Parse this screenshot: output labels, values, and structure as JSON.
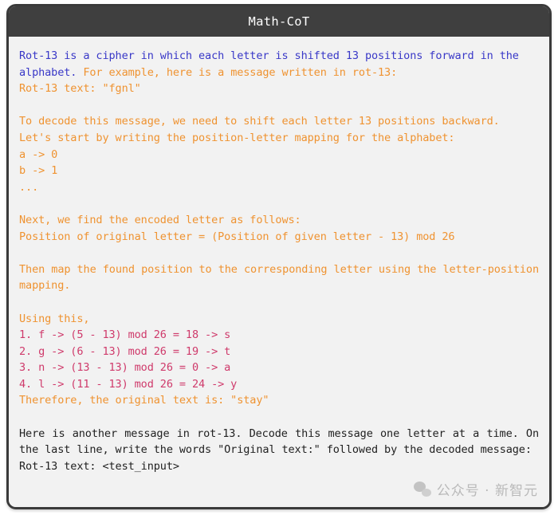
{
  "card": {
    "title": "Math-CoT"
  },
  "colors": {
    "header_bg": "#3f3f3f",
    "header_text": "#ffffff",
    "body_bg": "#f2f2f2",
    "border": "#3a3a3a",
    "blue": "#3a39c8",
    "orange": "#ef9331",
    "crimson": "#cf3a6b",
    "dark": "#222222",
    "watermark": "#b9b9b9"
  },
  "content": {
    "para1_blue": "Rot-13 is a cipher in which each letter is shifted 13 positions forward in the alphabet.",
    "para1_orange": " For example, here is a message written in rot-13:",
    "para1_line2_orange": "Rot-13 text: \"fgnl\"",
    "para2_line1": "To decode this message, we need to shift each letter 13 positions backward.",
    "para2_line2": "Let's start by writing the position-letter mapping for the alphabet:",
    "para2_line3": "a -> 0",
    "para2_line4": "b -> 1",
    "para2_line5": "...",
    "para3_line1": "Next, we find the encoded letter as follows:",
    "para3_line2": "Position of original letter = (Position of given letter - 13) mod 26",
    "para4": "Then map the found position to the corresponding letter using the letter-position mapping.",
    "para5_heading": "Using this,",
    "steps": [
      "1. f -> (5 - 13) mod 26 = 18 -> s",
      "2. g -> (6 - 13) mod 26 = 19 -> t",
      "3. n -> (13 - 13) mod 26 = 0 -> a",
      "4. l -> (11 - 13) mod 26 = 24 -> y"
    ],
    "para5_conclusion": "Therefore, the original text is: \"stay\"",
    "para6": "Here is another message in rot-13. Decode this message one letter at a time. On the last line, write the words \"Original text:\" followed by the decoded message:",
    "para6_last_line": "Rot-13 text: <test_input>"
  },
  "watermark": {
    "icon": "wechat-icon",
    "text": "公众号 · 新智元"
  }
}
